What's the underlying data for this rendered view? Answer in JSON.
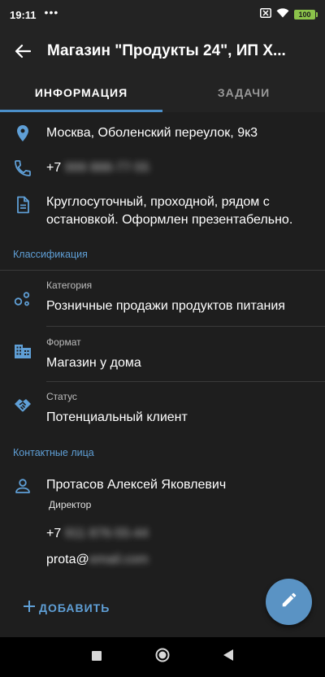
{
  "status_bar": {
    "time": "19:11",
    "dots": "•••",
    "battery": "100"
  },
  "app_bar": {
    "title": "Магазин \"Продукты 24\", ИП Х..."
  },
  "tabs": [
    {
      "label": "ИНФОРМАЦИЯ",
      "active": true
    },
    {
      "label": "ЗАДАЧИ",
      "active": false
    }
  ],
  "info": {
    "address": "Москва, Оболенский переулок, 9к3",
    "phone_prefix": "+7",
    "phone_hidden": "999 888-77-55",
    "description": "Круглосуточный, проходной, рядом с остановкой. Оформлен презентабельно."
  },
  "classification": {
    "section_label": "Классификация",
    "category_label": "Категория",
    "category_value": "Розничные продажи продуктов питания",
    "format_label": "Формат",
    "format_value": "Магазин у дома",
    "status_label": "Статус",
    "status_value": "Потенциальный клиент"
  },
  "contacts": {
    "section_label": "Контактные лица",
    "name": "Протасов Алексей Яковлевич",
    "role": "Директор",
    "phone_prefix": "+7",
    "phone_hidden": "911 876-55-44",
    "email_prefix": "prota@",
    "email_hidden": "email.com",
    "add_label": "ДОБАВИТЬ"
  },
  "colors": {
    "accent": "#5f9fd6",
    "fab": "#5a93c4",
    "background": "#1e1e1e",
    "header": "#232323"
  },
  "icons": {
    "back": "arrow-left",
    "address": "location-pin",
    "phone": "phone",
    "description": "document",
    "category": "category-bubbles",
    "format": "building",
    "status": "handshake",
    "contact": "person",
    "add": "plus",
    "fab": "pencil"
  }
}
